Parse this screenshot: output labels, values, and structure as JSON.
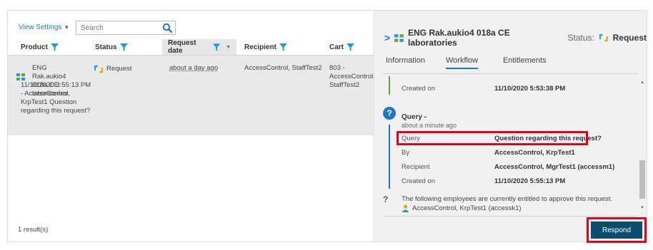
{
  "left": {
    "view_settings": "View Settings",
    "search_placeholder": "Search",
    "columns": {
      "product": "Product",
      "status": "Status",
      "request_date": "Request date",
      "recipient": "Recipient",
      "cart": "Cart"
    },
    "row": {
      "product_name": "ENG Rak.aukio4 018a CE laboratories",
      "product_detail": "11/10/2020 3:55:13 PM - AccessControl, KrpTest1 Question regarding this request?",
      "status": "Request",
      "request_date": "about a day ago",
      "recipient": "AccessControl, StaffTest2",
      "cart": "803 - AccessControl, StaffTest2"
    },
    "results": "1 result(s)"
  },
  "right": {
    "title": "ENG Rak.aukio4 018a CE laboratories",
    "status_label": "Status:",
    "status_value": "Request",
    "tabs": [
      "Information",
      "Workflow",
      "Entitlements"
    ],
    "active_tab": "Workflow",
    "workflow": {
      "created_on_label": "Created on",
      "created_on_value": "11/10/2020 5:53:38 PM",
      "query_title": "Query -",
      "query_sub": "about a minute ago",
      "query_label": "Query",
      "query_value": "Question regarding this request?",
      "by_label": "By",
      "by_value": "AccessControl, KrpTest1",
      "recipient_label": "Recipient",
      "recipient_value": "AccessControl, MgrTest1 (accessm1)",
      "created_on2_label": "Created on",
      "created_on2_value": "11/10/2020 5:55:13 PM",
      "approve_text": "The following employees are currently entitled to approve this request.",
      "approver": "AccessControl, KrpTest1 (accessk1)"
    },
    "respond_label": "Respond"
  },
  "colors": {
    "accent": "#1f77c8",
    "highlight": "#e0001b",
    "respond_bg": "#0b4d6e",
    "status_green": "#6aa043"
  }
}
